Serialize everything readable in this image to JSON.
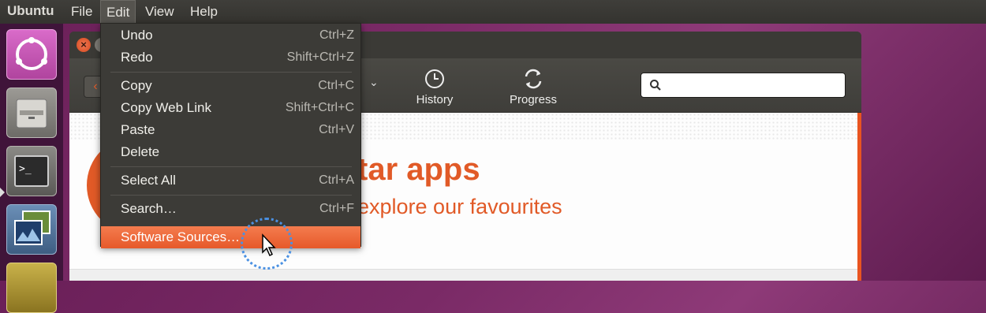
{
  "panel": {
    "app_name": "Ubuntu",
    "menus": [
      {
        "label": "File"
      },
      {
        "label": "Edit"
      },
      {
        "label": "View"
      },
      {
        "label": "Help"
      }
    ]
  },
  "toolbar": {
    "history_label": "History",
    "progress_label": "Progress",
    "search_placeholder": ""
  },
  "content": {
    "heading": "tar apps",
    "subheading": "explore our favourites"
  },
  "edit_menu": {
    "items": [
      {
        "label": "Undo",
        "accel": "Ctrl+Z"
      },
      {
        "label": "Redo",
        "accel": "Shift+Ctrl+Z"
      },
      {
        "label": "Copy",
        "accel": "Ctrl+C"
      },
      {
        "label": "Copy Web Link",
        "accel": "Shift+Ctrl+C"
      },
      {
        "label": "Paste",
        "accel": "Ctrl+V"
      },
      {
        "label": "Delete",
        "accel": ""
      },
      {
        "label": "Select All",
        "accel": "Ctrl+A"
      },
      {
        "label": "Search…",
        "accel": "Ctrl+F"
      },
      {
        "label": "Software Sources…",
        "accel": ""
      }
    ],
    "highlighted": "Software Sources…"
  },
  "colors": {
    "accent": "#e95420",
    "panel": "#3c3b37",
    "launcher": "#3c1437"
  }
}
